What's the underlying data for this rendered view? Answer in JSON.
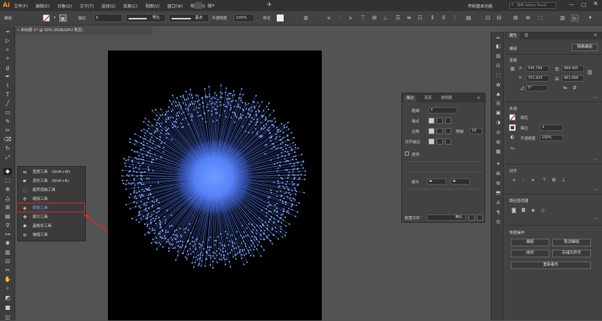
{
  "app": {
    "logo": "Ai"
  },
  "menu": [
    "文件(F)",
    "编辑(E)",
    "对象(O)",
    "文字(T)",
    "选择(S)",
    "效果(C)",
    "视图(V)",
    "窗口(W)",
    "帮助(H)"
  ],
  "workspace": {
    "label": "传统基本功能",
    "search_placeholder": "搜索 Adobe Stock"
  },
  "control_bar": {
    "selection": "编组",
    "stroke_label": "描边",
    "stroke_profile": "等比",
    "brush": "基本",
    "opacity_label": "不透明度",
    "opacity_value": "100%",
    "style_label": "样式"
  },
  "document_tab": {
    "title": "未标题-1* @ 50% (RGB/GPU 预览)",
    "close": "×"
  },
  "tools_flyout": {
    "items": [
      {
        "label": "宽度工具　(Shift+W)",
        "icon": "width-icon",
        "selected": false
      },
      {
        "label": "变形工具　(Shift+R)",
        "icon": "warp-icon",
        "selected": false
      },
      {
        "label": "旋转扭曲工具",
        "icon": "twirl-icon",
        "selected": false
      },
      {
        "label": "缩拢工具",
        "icon": "pucker-icon",
        "selected": false
      },
      {
        "label": "膨胀工具",
        "icon": "bloat-icon",
        "selected": true
      },
      {
        "label": "扇贝工具",
        "icon": "scallop-icon",
        "selected": false
      },
      {
        "label": "晶格化工具",
        "icon": "crystallize-icon",
        "selected": false
      },
      {
        "label": "皱褶工具",
        "icon": "wrinkle-icon",
        "selected": false
      }
    ]
  },
  "stroke_panel": {
    "tabs": [
      "描边",
      "渐变",
      "透明度"
    ],
    "weight_label": "粗细",
    "cap_label": "端点",
    "corner_label": "边角",
    "limit_label": "限制",
    "limit_value": "10",
    "align_label": "对齐描边",
    "dashed_label": "虚线",
    "arrow_label": "箭头",
    "profile_label": "配置文件",
    "profile_value": "等比"
  },
  "properties_panel": {
    "tabs": [
      "属性",
      "库"
    ],
    "group_label": "编组",
    "isolate_button": "隔离编组",
    "transform_label": "变换",
    "x_label": "X:",
    "x_value": "545.704",
    "y_label": "Y:",
    "y_value": "701.924",
    "w_label": "宽:",
    "w_value": "968.405",
    "h_label": "高:",
    "h_value": "961.066",
    "angle_value": "0°",
    "appearance_label": "外观",
    "fill_label": "填色",
    "stroke_label": "描边",
    "opacity_label": "不透明度",
    "opacity_value": "100%",
    "fx_label": "fx.",
    "align_label": "对齐",
    "pathfinder_label": "路径查找器",
    "quick_actions_label": "快速操作",
    "btn_ungroup": "取消编组",
    "btn_arrange": "排列",
    "btn_recolor": "重新着色",
    "btn_shortcut1": "编组",
    "btn_shortcut2": "存储为符号"
  },
  "colors": {
    "accent": "#6fa8ff",
    "highlight_box": "#d8262b",
    "artboard": "#000000",
    "burst": "#5b86ff"
  }
}
